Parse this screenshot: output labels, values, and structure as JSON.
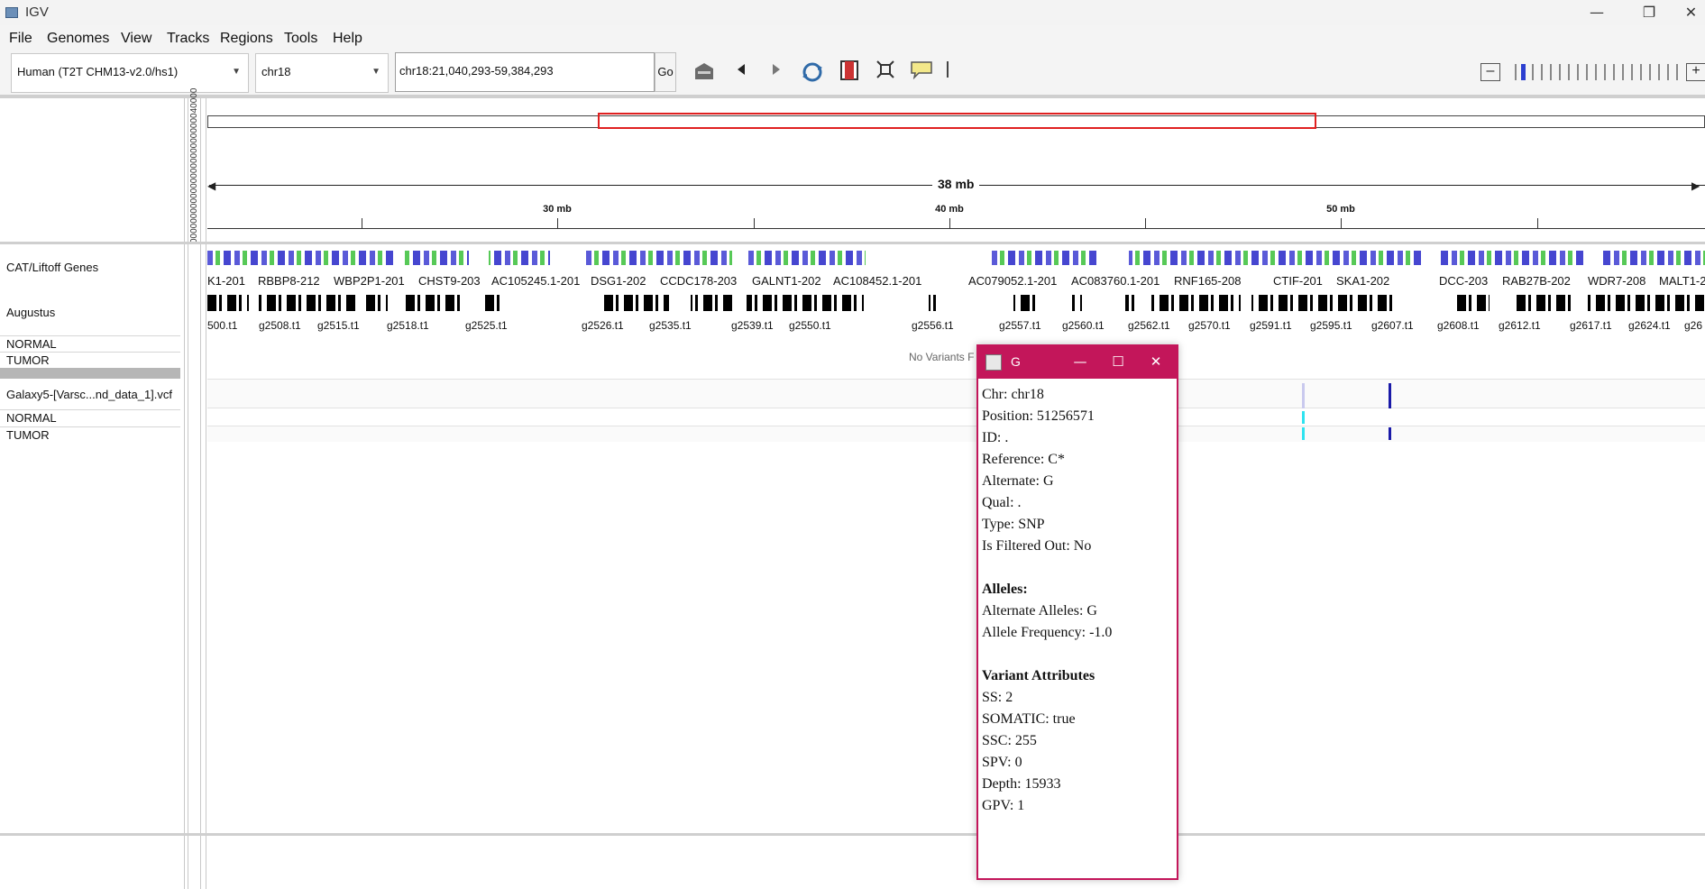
{
  "window": {
    "title": "IGV",
    "minimize": "—",
    "restore": "❐",
    "close": "✕"
  },
  "menu": [
    "File",
    "Genomes",
    "View",
    "Tracks",
    "Regions",
    "Tools",
    "Help"
  ],
  "toolbar": {
    "genome": "Human (T2T CHM13-v2.0/hs1)",
    "chromosome": "chr18",
    "locus": "chr18:21,040,293-59,384,293",
    "go_label": "Go"
  },
  "header": {
    "ideogram_ticks": "0000000000000000000000000040000",
    "span_label": "38 mb",
    "ruler_labels": [
      "30 mb",
      "40 mb",
      "50 mb"
    ]
  },
  "tracks": {
    "cat_liftoff": "CAT/Liftoff Genes",
    "augustus": "Augustus",
    "sample_normal": "NORMAL",
    "sample_tumor": "TUMOR",
    "vcf_name": "Galaxy5-[Varsc...nd_data_1].vcf",
    "vcf_normal": "NORMAL",
    "vcf_tumor": "TUMOR",
    "no_variants": "No Variants F"
  },
  "gene_labels": [
    "K1-201",
    "RBBP8-212",
    "WBP2P1-201",
    "CHST9-203",
    "AC105245.1-201",
    "DSG1-202",
    "CCDC178-203",
    "GALNT1-202",
    "AC108452.1-201",
    "AC079052.1-201",
    "AC083760.1-201",
    "RNF165-208",
    "CTIF-201",
    "SKA1-202",
    "DCC-203",
    "RAB27B-202",
    "WDR7-208",
    "MALT1-2"
  ],
  "augustus_labels": [
    "500.t1",
    "g2508.t1",
    "g2515.t1",
    "g2518.t1",
    "g2525.t1",
    "g2526.t1",
    "g2535.t1",
    "g2539.t1",
    "g2550.t1",
    "g2556.t1",
    "g2557.t1",
    "g2560.t1",
    "g2562.t1",
    "g2570.t1",
    "g2591.t1",
    "g2595.t1",
    "g2607.t1",
    "g2608.t1",
    "g2612.t1",
    "g2617.t1",
    "g2624.t1",
    "g26"
  ],
  "popup": {
    "title": "G",
    "lines": [
      {
        "text": "Chr: chr18",
        "bold": false
      },
      {
        "text": "Position: 51256571",
        "bold": false
      },
      {
        "text": "ID: .",
        "bold": false
      },
      {
        "text": "Reference: C*",
        "bold": false
      },
      {
        "text": "Alternate: G",
        "bold": false
      },
      {
        "text": "Qual: .",
        "bold": false
      },
      {
        "text": "Type: SNP",
        "bold": false
      },
      {
        "text": "Is Filtered Out: No",
        "bold": false
      },
      {
        "text": "",
        "bold": false
      },
      {
        "text": "Alleles:",
        "bold": true
      },
      {
        "text": "Alternate Alleles: G",
        "bold": false
      },
      {
        "text": "Allele Frequency: -1.0",
        "bold": false
      },
      {
        "text": "",
        "bold": false
      },
      {
        "text": "Variant Attributes",
        "bold": true
      },
      {
        "text": "SS: 2",
        "bold": false
      },
      {
        "text": "SOMATIC: true",
        "bold": false
      },
      {
        "text": "SSC: 255",
        "bold": false
      },
      {
        "text": "SPV: 0",
        "bold": false
      },
      {
        "text": "Depth: 15933",
        "bold": false
      },
      {
        "text": "GPV: 1",
        "bold": false
      }
    ]
  },
  "colors": {
    "popup_accent": "#c3165a",
    "region_box": "#e02020",
    "variant_het": "#2ee3f0",
    "variant_hom": "#1a1aa8"
  }
}
